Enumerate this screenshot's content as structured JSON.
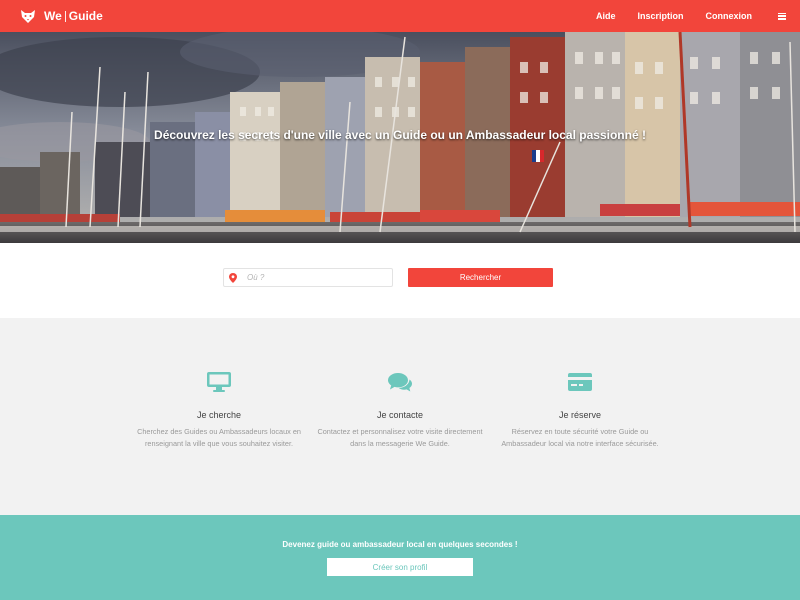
{
  "header": {
    "logo_word_1": "We",
    "logo_word_2": "Guide",
    "nav": [
      "Aide",
      "Inscription",
      "Connexion"
    ],
    "menu_icon": "hamburger-menu-icon",
    "logo_icon": "fox-head-icon"
  },
  "hero": {
    "title": "Découvrez les secrets d'une ville avec un Guide ou un Ambassadeur local passionné !"
  },
  "search": {
    "placeholder": "Où ?",
    "value": "",
    "button_label": "Rechercher",
    "icon": "location-pin-icon"
  },
  "features": [
    {
      "icon": "monitor-icon",
      "title": "Je cherche",
      "description": "Cherchez des Guides ou Ambassadeurs locaux en renseignant la ville que vous souhaitez visiter."
    },
    {
      "icon": "chat-bubbles-icon",
      "title": "Je contacte",
      "description": "Contactez et personnalisez votre visite directement dans la messagerie We Guide."
    },
    {
      "icon": "credit-card-icon",
      "title": "Je réserve",
      "description": "Réservez en toute sécurité votre Guide ou Ambassadeur local via notre interface sécurisée."
    }
  ],
  "cta": {
    "text": "Devenez guide ou ambassadeur local en quelques secondes !",
    "button_label": "Créer son profil"
  },
  "colors": {
    "brand_red": "#f2453b",
    "teal": "#6cc7bc",
    "feature_bg": "#f2f2f2"
  }
}
